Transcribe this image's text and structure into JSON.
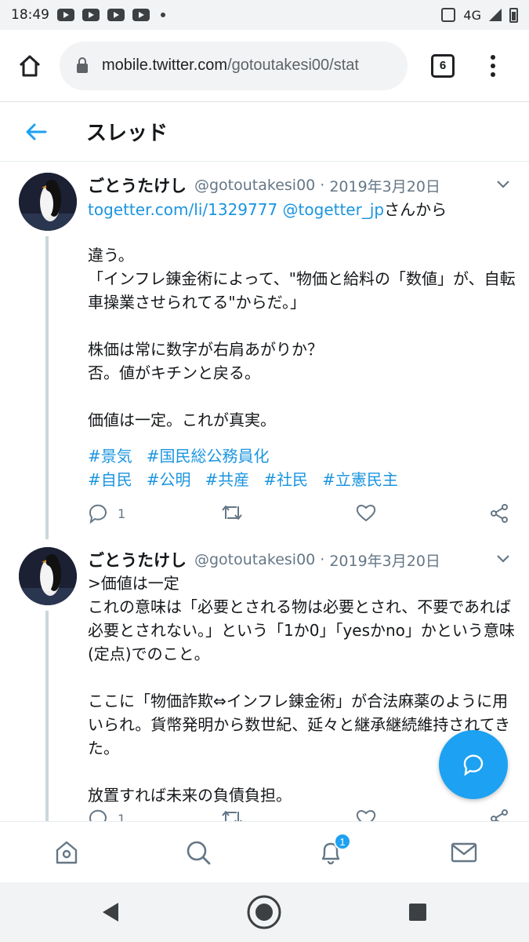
{
  "status_bar": {
    "time": "18:49",
    "network": "4G"
  },
  "browser": {
    "url_host": "mobile.twitter.com",
    "url_path": "/gotoutakesi00/stat",
    "tab_count": "6"
  },
  "header": {
    "title": "スレッド"
  },
  "tweets": [
    {
      "name": "ごとうたけし",
      "handle": "@gotoutakesi00",
      "separator": "·",
      "date": "2019年3月20日",
      "link1": "togetter.com/li/1329777",
      "link2": "@togetter_jp",
      "link_suffix": "さんから",
      "text": "違う。\n「インフレ錬金術によって、\"物価と給料の「数値」が、自転車操業させられてる\"からだ。」\n\n株価は常に数字が右肩あがりか？\n否。値がキチンと戻る。\n\n価値は一定。これが真実。",
      "hashtags": [
        "#景気",
        "#国民総公務員化",
        "#自民",
        "#公明",
        "#共産",
        "#社民",
        "#立憲民主"
      ],
      "reply_count": "1"
    },
    {
      "name": "ごとうたけし",
      "handle": "@gotoutakesi00",
      "separator": "·",
      "date": "2019年3月20日",
      "text": ">価値は一定\nこれの意味は「必要とされる物は必要とされ、不要であれば必要とされない。」という「1か0」「yesかno」かという意味(定点)でのこと。\n\nここに「物価詐欺⇔インフレ錬金術」が合法麻薬のように用いられ。貨幣発明から数世紀、延々と継承継続維持されてきた。\n\n放置すれば未来の負債負担。",
      "reply_count": "1"
    }
  ],
  "bottom_nav": {
    "notification_badge": "1"
  },
  "colors": {
    "accent": "#1da1f2",
    "link": "#1b95e0",
    "muted": "#657786"
  }
}
